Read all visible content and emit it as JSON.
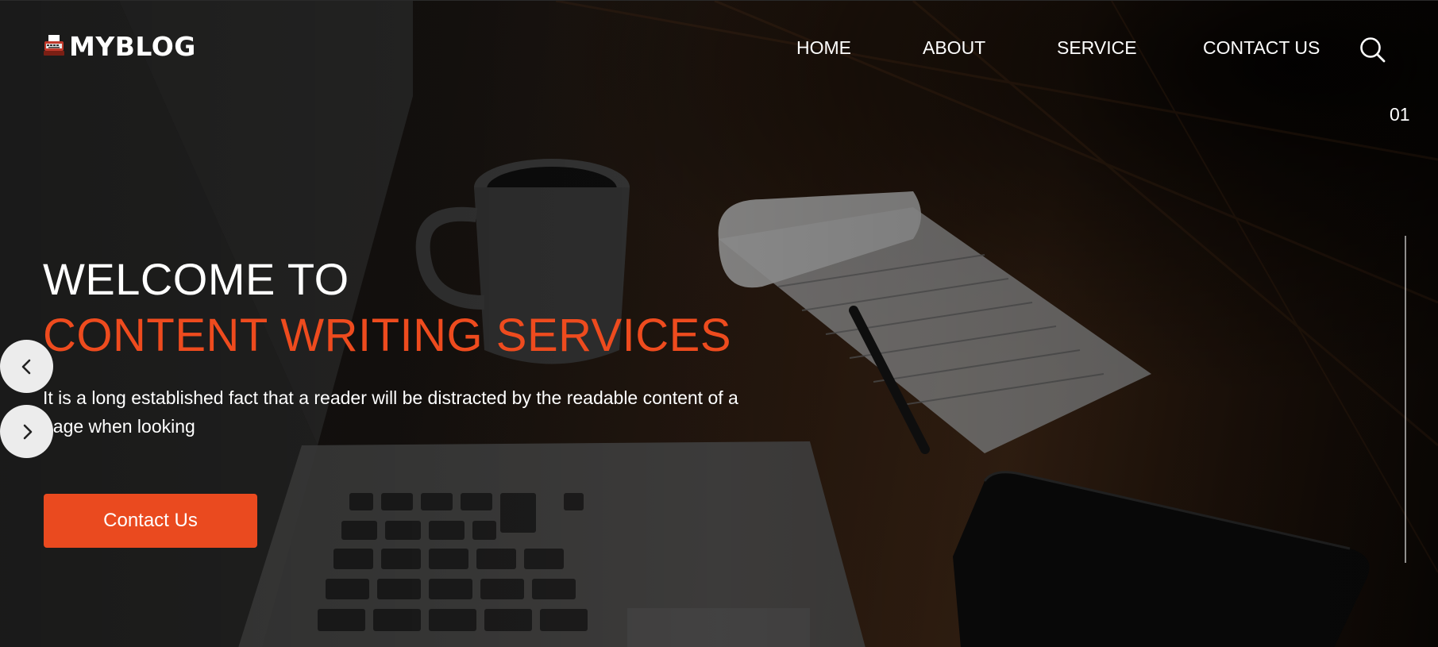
{
  "brand": {
    "name": "MYBLOG",
    "logo_icon": "typewriter-icon"
  },
  "nav": {
    "items": [
      {
        "label": "HOME"
      },
      {
        "label": "ABOUT"
      },
      {
        "label": "SERVICE"
      },
      {
        "label": "CONTACT US"
      }
    ],
    "search_icon": "search-icon"
  },
  "slider": {
    "current_slide": "01",
    "prev_icon": "chevron-left-icon",
    "next_icon": "chevron-right-icon"
  },
  "hero": {
    "welcome": "WELCOME TO",
    "heading": "CONTENT WRITING SERVICES",
    "description": "It is a long established fact that a reader will be distracted by the readable content of a page when looking",
    "cta_label": "Contact Us"
  },
  "colors": {
    "accent": "#ea4a1f",
    "heading_accent": "#ee4b1e",
    "text": "#ffffff",
    "arrow_bg": "#ececec"
  }
}
